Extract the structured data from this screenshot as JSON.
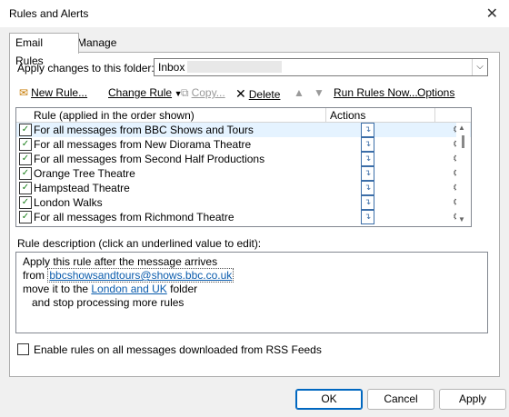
{
  "window": {
    "title": "Rules and Alerts",
    "close_glyph": "✕"
  },
  "tabs": [
    {
      "label": "Email Rules"
    },
    {
      "label": "Manage Alerts"
    }
  ],
  "folder": {
    "label": "Apply changes to this folder:",
    "value": "Inbox"
  },
  "toolbar": {
    "new_rule": "New Rule...",
    "change_rule": "Change Rule",
    "copy": "Copy...",
    "delete": "Delete",
    "run_rules": "Run Rules Now...",
    "options": "Options"
  },
  "list": {
    "col_rule": "Rule (applied in the order shown)",
    "col_actions": "Actions",
    "rows": [
      {
        "label": "For all messages from BBC Shows and Tours",
        "checked": true,
        "selected": true
      },
      {
        "label": "For all messages from New Diorama Theatre",
        "checked": true,
        "selected": false
      },
      {
        "label": "For all messages from Second Half Productions",
        "checked": true,
        "selected": false
      },
      {
        "label": "Orange Tree Theatre",
        "checked": true,
        "selected": false
      },
      {
        "label": "Hampstead Theatre",
        "checked": true,
        "selected": false
      },
      {
        "label": "London Walks",
        "checked": true,
        "selected": false
      },
      {
        "label": "For all messages from Richmond Theatre",
        "checked": true,
        "selected": false
      }
    ]
  },
  "description": {
    "label": "Rule description (click an underlined value to edit):",
    "line1": "Apply this rule after the message arrives",
    "line2_prefix": "from ",
    "line2_link": "bbcshowsandtours@shows.bbc.co.uk",
    "line3_prefix": "move it to the ",
    "line3_link": "London and UK",
    "line3_suffix": " folder",
    "line4": "and stop processing more rules"
  },
  "rss": {
    "label": "Enable rules on all messages downloaded from RSS Feeds"
  },
  "buttons": {
    "ok": "OK",
    "cancel": "Cancel",
    "apply": "Apply"
  },
  "colors": {
    "selection": "#e5f3ff",
    "link": "#0b5cad",
    "primary_border": "#0067c0"
  }
}
